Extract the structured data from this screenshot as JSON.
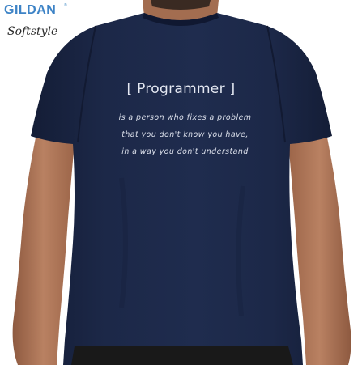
{
  "brand": {
    "name": "GILDAN",
    "mark": "®",
    "subline": "Softstyle",
    "name_color": "#3d83c6",
    "subline_color": "#2b2b2b"
  },
  "shirt_print": {
    "title": "[ Programmer ]",
    "lines": [
      "is a person who fixes a problem",
      "that you don't know you have,",
      "in a way you don't understand"
    ],
    "text_color": "#e4e8f2"
  },
  "colors": {
    "shirt": "#1c2848",
    "shirt_shadow": "#141d36",
    "skin": "#b98162",
    "skin_dark": "#8e5a40",
    "hair": "#3a2a22",
    "background": "#ffffff"
  },
  "icons": [
    "gildan-logo",
    "tshirt-icon"
  ]
}
